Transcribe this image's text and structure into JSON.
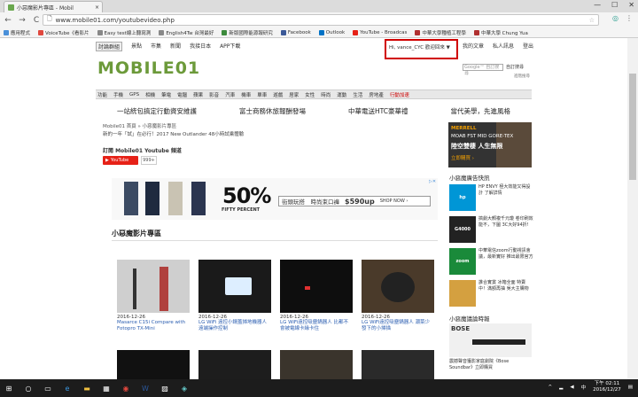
{
  "browser": {
    "tab_title": "小惡魔影片專區 - Mobil",
    "url": "www.mobile01.com/youtubevideo.php",
    "back_icon": "←",
    "forward_icon": "→",
    "reload_icon": "C",
    "window_buttons": [
      "—",
      "☐",
      "✕"
    ],
    "bookmarks": [
      {
        "label": "應用程式",
        "color": "#4a90d9"
      },
      {
        "label": "VoiceTube《看影片",
        "color": "#e0483e"
      },
      {
        "label": "Easy test線上聽寫測",
        "color": "#888888"
      },
      {
        "label": "English4Tw 台灣最好",
        "color": "#888888"
      },
      {
        "label": "新版國際能源報研究",
        "color": "#3d8b3d"
      },
      {
        "label": "Facebook",
        "color": "#3b5998"
      },
      {
        "label": "Outlook",
        "color": "#0072c6"
      },
      {
        "label": "YouTube - Broadcas",
        "color": "#e62117"
      },
      {
        "label": "中華大學種植工程學",
        "color": "#b03030"
      },
      {
        "label": "中華大學 Chung Yua",
        "color": "#b03030"
      }
    ]
  },
  "site": {
    "logo": "MOBILE01",
    "top_nav": [
      "討論群組",
      "景點",
      "市集",
      "新聞",
      "我接日本",
      "APP下載"
    ],
    "user_menu": "Hi, vance_CYC 歡迎回來 ▼",
    "user_links": [
      "我的文章",
      "私人訊息",
      "登出"
    ],
    "search_placeholder": "Google™ 自訂搜尋",
    "search_button": "自訂搜尋",
    "advanced_search": "進階搜尋",
    "categories": [
      "功能",
      "手機",
      "GPS",
      "相機",
      "筆電",
      "電腦",
      "蘋果",
      "影音",
      "汽車",
      "機車",
      "單車",
      "遊戲",
      "居家",
      "女性",
      "時尚",
      "運動",
      "生活",
      "房地產",
      "行動加速"
    ],
    "promos": [
      "一站統包搞定行動資安維護",
      "富士商務休旅報酬發場",
      "中華電送HTC豪華禮",
      "當代美學，先進風格"
    ],
    "breadcrumb": "Mobile01 首頁 » 小惡魔影片專區",
    "news_line": "新的一年「試」在必行！2017 New Outlander 48小時試乘體驗",
    "subscribe_title": "訂閱 Mobile01 Youtube 頻道",
    "youtube_label": "YouTube",
    "youtube_count": "999+",
    "section_title": "小惡魔影片專區"
  },
  "right_ad": {
    "line1": "MERRELL",
    "line2": "MOAB FST MID GORE-TEX",
    "line3": "陸空雙棲 人生無限",
    "line4": "立即購買 ›"
  },
  "banner": {
    "percent": "50%",
    "percent_sub": "FIFTY PERCENT",
    "tagline": "街頭玩搭　時尚束口褲",
    "price": "$590up",
    "shop": "SHOP NOW ›",
    "ad_mark": "▷✕"
  },
  "videos": [
    {
      "date": "2016-12-26",
      "title": "Masarce C15i Compare with Fotopro TX-Mini"
    },
    {
      "date": "2016-12-26",
      "title": "LG WiFi 遠控小鍋蓋掃地機器人 遠端操作控制"
    },
    {
      "date": "2016-12-26",
      "title": "LG WiFi遠控吸塵鍋器人 比都不會被電線卡緣卡住"
    },
    {
      "date": "2016-12-26",
      "title": "LG WiFi遠控吸塵鍋器人 潮菜少發下的小掃描"
    }
  ],
  "sidebar": {
    "hd1": "小惡魔廣告快訊",
    "items": [
      {
        "img": "hp",
        "color": "#0096d6",
        "text": "HP ENVY 極大效能又得設計 了解詳情"
      },
      {
        "img": "G4000",
        "color": "#222222",
        "text": "搞劇大顏複千元瓊 卷印刷效能不，下圖 3C大好94折!"
      },
      {
        "img": "zoom",
        "color": "#1a8a3a",
        "text": "中華電信zoom行動視訊會議，最新實好 推出最限官方"
      },
      {
        "img": "",
        "color": "#d4a040",
        "text": "誰合實賞 冰箱全面 特賣中！滿額再抽 吳大主購物"
      }
    ],
    "hd2": "小惡魔議論時報",
    "bottom": "震撼聲音獲影家庭劇院《Bose Soundbar》立即購買"
  },
  "taskbar": {
    "time": "下午 02:11",
    "date": "2016/12/27",
    "lang": "中"
  }
}
